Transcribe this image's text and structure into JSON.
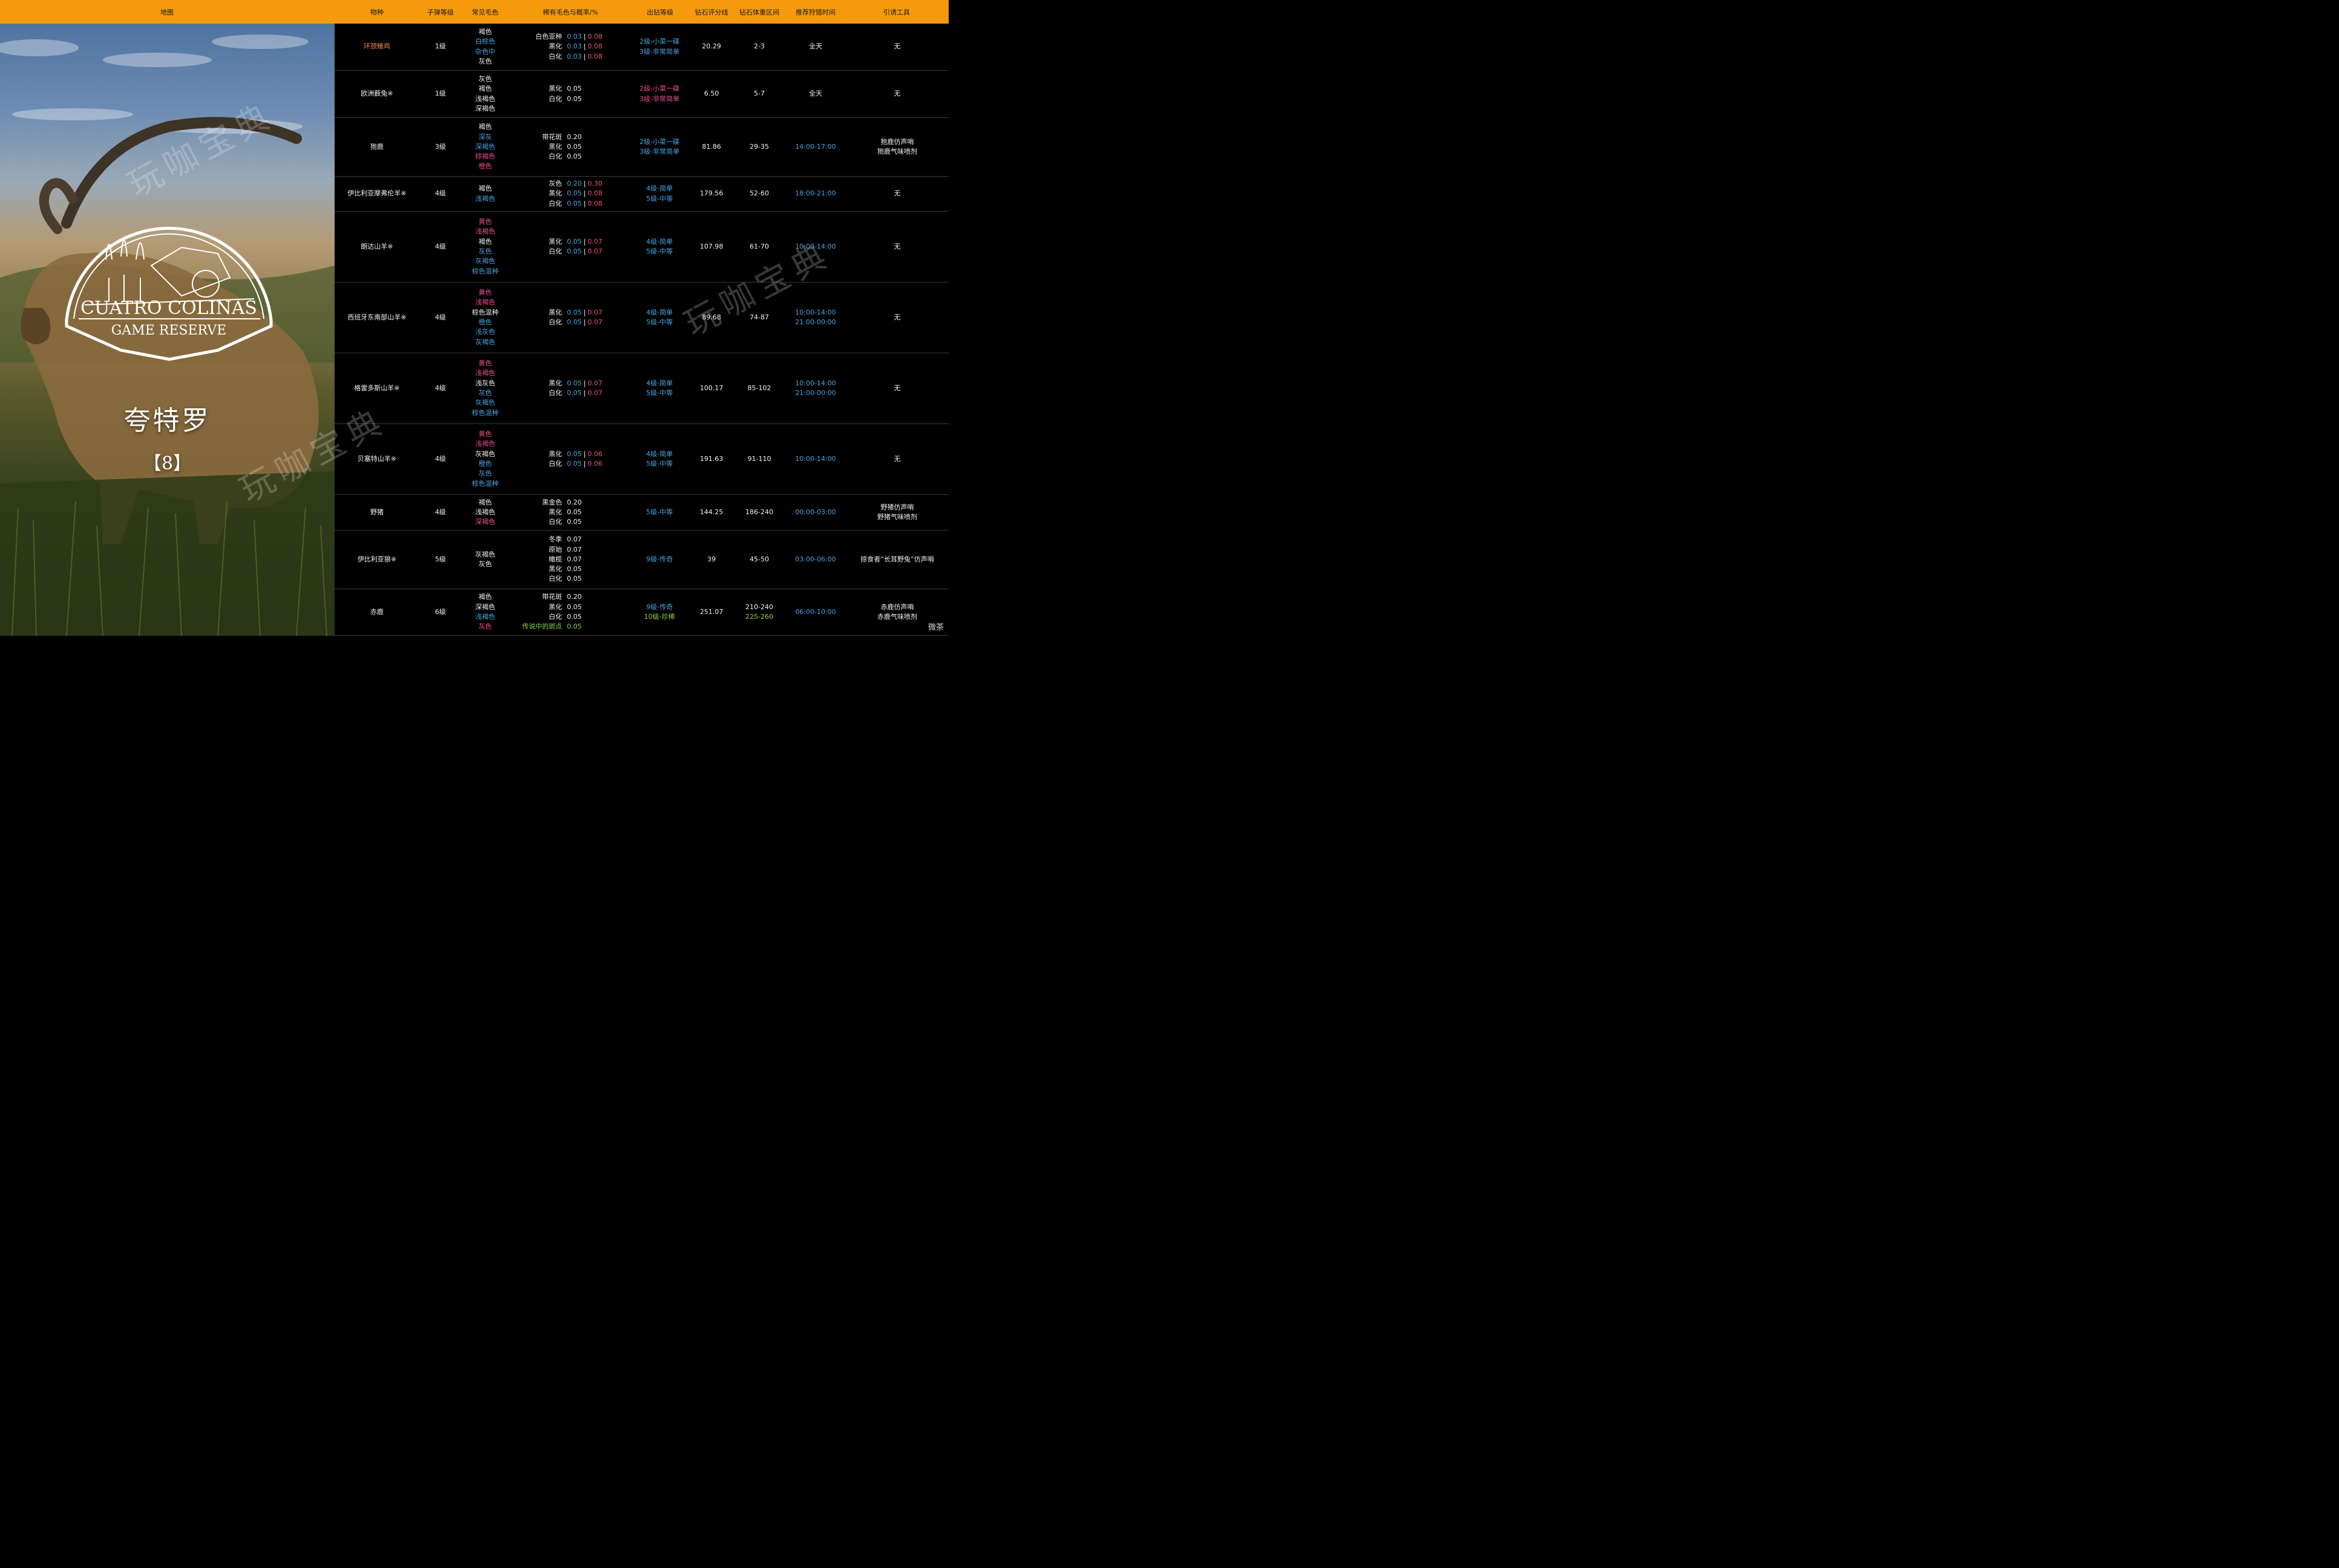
{
  "header": {
    "map": "地图",
    "species": "物种",
    "bullet": "子弹等级",
    "fur": "常见毛色",
    "rare": "稀有毛色与概率/%",
    "diamond_rank": "出钻等级",
    "score": "钻石评分线",
    "weight": "钻石体重区间",
    "time": "推荐狩猎时间",
    "lure": "引诱工具"
  },
  "map": {
    "logo_line1": "CUATRO COLINAS",
    "logo_line2": "GAME RESERVE",
    "name": "夸特罗",
    "count": "【8】",
    "watermark": "玩咖宝典"
  },
  "colors": {
    "white": "#f2f2f2",
    "blue": "#4aa3e0",
    "pink": "#e94f8c",
    "orange": "#f08a4b",
    "green": "#8fcf58",
    "header": "#f59a0c"
  },
  "rows": [
    {
      "species": {
        "text": "环颈雉鸡",
        "color": "o"
      },
      "bullet": "1级",
      "fur": [
        {
          "t": "褐色",
          "c": "w"
        },
        {
          "t": "白棕色",
          "c": "b"
        },
        {
          "t": "杂色中",
          "c": "b"
        },
        {
          "t": "灰色",
          "c": "w"
        }
      ],
      "rare": [
        {
          "name": "白色亚种",
          "nc": "w",
          "v1": "0.03",
          "c1": "b",
          "v2": "0.08",
          "c2": "p"
        },
        {
          "name": "黑化",
          "nc": "w",
          "v1": "0.03",
          "c1": "b",
          "v2": "0.08",
          "c2": "p"
        },
        {
          "name": "白化",
          "nc": "w",
          "v1": "0.03",
          "c1": "b",
          "v2": "0.08",
          "c2": "p"
        }
      ],
      "rank": [
        {
          "t": "2级-小菜一碟",
          "c": "b"
        },
        {
          "t": "3级-非常简单",
          "c": "b"
        }
      ],
      "score": "20.29",
      "weight": [
        {
          "t": "2-3",
          "c": "w"
        }
      ],
      "time": [
        {
          "t": "全天",
          "c": "w"
        }
      ],
      "lure": [
        "无"
      ]
    },
    {
      "species": {
        "text": "欧洲薮兔※",
        "color": "w"
      },
      "bullet": "1级",
      "fur": [
        {
          "t": "灰色",
          "c": "w"
        },
        {
          "t": "褐色",
          "c": "w"
        },
        {
          "t": "浅褐色",
          "c": "w"
        },
        {
          "t": "深褐色",
          "c": "w"
        }
      ],
      "rare": [
        {
          "name": "黑化",
          "nc": "w",
          "v1": "0.05",
          "c1": "w"
        },
        {
          "name": "白化",
          "nc": "w",
          "v1": "0.05",
          "c1": "w"
        }
      ],
      "rank": [
        {
          "t": "2级-小菜一碟",
          "c": "p"
        },
        {
          "t": "3级-非常简单",
          "c": "p"
        }
      ],
      "score": "6.50",
      "weight": [
        {
          "t": "5-7",
          "c": "w"
        }
      ],
      "time": [
        {
          "t": "全天",
          "c": "w"
        }
      ],
      "lure": [
        "无"
      ]
    },
    {
      "species": {
        "text": "狍鹿",
        "color": "w"
      },
      "bullet": "3级",
      "fur": [
        {
          "t": "褐色",
          "c": "w"
        },
        {
          "t": "深灰",
          "c": "b"
        },
        {
          "t": "深褐色",
          "c": "b"
        },
        {
          "t": "棕褐色",
          "c": "p"
        },
        {
          "t": "橙色",
          "c": "p"
        }
      ],
      "rare": [
        {
          "name": "带花斑",
          "nc": "w",
          "v1": "0.20",
          "c1": "w"
        },
        {
          "name": "黑化",
          "nc": "w",
          "v1": "0.05",
          "c1": "w"
        },
        {
          "name": "白化",
          "nc": "w",
          "v1": "0.05",
          "c1": "w"
        }
      ],
      "rank": [
        {
          "t": "2级-小菜一碟",
          "c": "b"
        },
        {
          "t": "3级-非常简单",
          "c": "b"
        }
      ],
      "score": "81.86",
      "weight": [
        {
          "t": "29-35",
          "c": "w"
        }
      ],
      "time": [
        {
          "t": "14:00-17:00",
          "c": "b"
        }
      ],
      "lure": [
        "狍鹿仿声哨",
        "狍鹿气味喷剂"
      ]
    },
    {
      "species": {
        "text": "伊比利亚摩弗伦羊※",
        "color": "w"
      },
      "bullet": "4级",
      "fur": [
        {
          "t": "褐色",
          "c": "w"
        },
        {
          "t": "浅褐色",
          "c": "b"
        }
      ],
      "rare": [
        {
          "name": "灰色",
          "nc": "w",
          "v1": "0.20",
          "c1": "b",
          "v2": "0.30",
          "c2": "p"
        },
        {
          "name": "黑化",
          "nc": "w",
          "v1": "0.05",
          "c1": "b",
          "v2": "0.08",
          "c2": "p"
        },
        {
          "name": "白化",
          "nc": "w",
          "v1": "0.05",
          "c1": "b",
          "v2": "0.08",
          "c2": "p"
        }
      ],
      "rank": [
        {
          "t": "4级-简单",
          "c": "b"
        },
        {
          "t": "5级-中等",
          "c": "b"
        }
      ],
      "score": "179.56",
      "weight": [
        {
          "t": "52-60",
          "c": "w"
        }
      ],
      "time": [
        {
          "t": "18:00-21:00",
          "c": "b"
        }
      ],
      "lure": [
        "无"
      ]
    },
    {
      "species": {
        "text": "朗达山羊※",
        "color": "w"
      },
      "bullet": "4级",
      "fur": [
        {
          "t": "黄色",
          "c": "p"
        },
        {
          "t": "浅褐色",
          "c": "p"
        },
        {
          "t": "褐色",
          "c": "w"
        },
        {
          "t": "灰色",
          "c": "b"
        },
        {
          "t": "灰褐色",
          "c": "b"
        },
        {
          "t": "棕色混种",
          "c": "b"
        }
      ],
      "rare": [
        {
          "name": "黑化",
          "nc": "w",
          "v1": "0.05",
          "c1": "b",
          "v2": "0.07",
          "c2": "p"
        },
        {
          "name": "白化",
          "nc": "w",
          "v1": "0.05",
          "c1": "b",
          "v2": "0.07",
          "c2": "p"
        }
      ],
      "rank": [
        {
          "t": "4级-简单",
          "c": "b"
        },
        {
          "t": "5级-中等",
          "c": "b"
        }
      ],
      "score": "107.98",
      "weight": [
        {
          "t": "61-70",
          "c": "w"
        }
      ],
      "time": [
        {
          "t": "10:00-14:00",
          "c": "b"
        }
      ],
      "lure": [
        "无"
      ]
    },
    {
      "species": {
        "text": "西班牙东南部山羊※",
        "color": "w"
      },
      "bullet": "4级",
      "fur": [
        {
          "t": "黄色",
          "c": "p"
        },
        {
          "t": "浅褐色",
          "c": "p"
        },
        {
          "t": "棕色混种",
          "c": "w"
        },
        {
          "t": "橙色",
          "c": "b"
        },
        {
          "t": "浅灰色",
          "c": "b"
        },
        {
          "t": "灰褐色",
          "c": "b"
        }
      ],
      "rare": [
        {
          "name": "黑化",
          "nc": "w",
          "v1": "0.05",
          "c1": "b",
          "v2": "0.07",
          "c2": "p"
        },
        {
          "name": "白化",
          "nc": "w",
          "v1": "0.05",
          "c1": "b",
          "v2": "0.07",
          "c2": "p"
        }
      ],
      "rank": [
        {
          "t": "4级-简单",
          "c": "b"
        },
        {
          "t": "5级-中等",
          "c": "b"
        }
      ],
      "score": "89.68",
      "weight": [
        {
          "t": "74-87",
          "c": "w"
        }
      ],
      "time": [
        {
          "t": "10:00-14:00",
          "c": "b"
        },
        {
          "t": "21:00-00:00",
          "c": "b"
        }
      ],
      "lure": [
        "无"
      ]
    },
    {
      "species": {
        "text": "格雷多斯山羊※",
        "color": "w"
      },
      "bullet": "4级",
      "fur": [
        {
          "t": "黄色",
          "c": "p"
        },
        {
          "t": "浅褐色",
          "c": "p"
        },
        {
          "t": "浅灰色",
          "c": "w"
        },
        {
          "t": "灰色",
          "c": "b"
        },
        {
          "t": "灰褐色",
          "c": "b"
        },
        {
          "t": "棕色混种",
          "c": "b"
        }
      ],
      "rare": [
        {
          "name": "黑化",
          "nc": "w",
          "v1": "0.05",
          "c1": "b",
          "v2": "0.07",
          "c2": "p"
        },
        {
          "name": "白化",
          "nc": "w",
          "v1": "0.05",
          "c1": "b",
          "v2": "0.07",
          "c2": "p"
        }
      ],
      "rank": [
        {
          "t": "4级-简单",
          "c": "b"
        },
        {
          "t": "5级-中等",
          "c": "b"
        }
      ],
      "score": "100.17",
      "weight": [
        {
          "t": "85-102",
          "c": "w"
        }
      ],
      "time": [
        {
          "t": "10:00-14:00",
          "c": "b"
        },
        {
          "t": "21:00-00:00",
          "c": "b"
        }
      ],
      "lure": [
        "无"
      ]
    },
    {
      "species": {
        "text": "贝塞特山羊※",
        "color": "w"
      },
      "bullet": "4级",
      "fur": [
        {
          "t": "黄色",
          "c": "p"
        },
        {
          "t": "浅褐色",
          "c": "p"
        },
        {
          "t": "灰褐色",
          "c": "w"
        },
        {
          "t": "橙色",
          "c": "b"
        },
        {
          "t": "灰色",
          "c": "b"
        },
        {
          "t": "棕色混种",
          "c": "b"
        }
      ],
      "rare": [
        {
          "name": "黑化",
          "nc": "w",
          "v1": "0.05",
          "c1": "b",
          "v2": "0.06",
          "c2": "p"
        },
        {
          "name": "白化",
          "nc": "w",
          "v1": "0.05",
          "c1": "b",
          "v2": "0.06",
          "c2": "p"
        }
      ],
      "rank": [
        {
          "t": "4级-简单",
          "c": "b"
        },
        {
          "t": "5级-中等",
          "c": "b"
        }
      ],
      "score": "191.63",
      "weight": [
        {
          "t": "91-110",
          "c": "w"
        }
      ],
      "time": [
        {
          "t": "10:00-14:00",
          "c": "b"
        }
      ],
      "lure": [
        "无"
      ]
    },
    {
      "species": {
        "text": "野猪",
        "color": "w"
      },
      "bullet": "4级",
      "fur": [
        {
          "t": "褐色",
          "c": "w"
        },
        {
          "t": "浅褐色",
          "c": "w"
        },
        {
          "t": "深褐色",
          "c": "p"
        }
      ],
      "rare": [
        {
          "name": "黑金色",
          "nc": "w",
          "v1": "0.20",
          "c1": "w"
        },
        {
          "name": "黑化",
          "nc": "w",
          "v1": "0.05",
          "c1": "w"
        },
        {
          "name": "白化",
          "nc": "w",
          "v1": "0.05",
          "c1": "w"
        }
      ],
      "rank": [
        {
          "t": "5级-中等",
          "c": "b"
        }
      ],
      "score": "144.25",
      "weight": [
        {
          "t": "186-240",
          "c": "w"
        }
      ],
      "time": [
        {
          "t": "00:00-03:00",
          "c": "b"
        }
      ],
      "lure": [
        "野猪仿声哨",
        "野猪气味喷剂"
      ]
    },
    {
      "species": {
        "text": "伊比利亚狼※",
        "color": "w"
      },
      "bullet": "5级",
      "fur": [
        {
          "t": "灰褐色",
          "c": "w"
        },
        {
          "t": "灰色",
          "c": "w"
        }
      ],
      "rare": [
        {
          "name": "冬季",
          "nc": "w",
          "v1": "0.07",
          "c1": "w"
        },
        {
          "name": "原始",
          "nc": "w",
          "v1": "0.07",
          "c1": "w"
        },
        {
          "name": "橄榄",
          "nc": "w",
          "v1": "0.07",
          "c1": "w"
        },
        {
          "name": "黑化",
          "nc": "w",
          "v1": "0.05",
          "c1": "w"
        },
        {
          "name": "白化",
          "nc": "w",
          "v1": "0.05",
          "c1": "w"
        }
      ],
      "rank": [
        {
          "t": "9级-传奇",
          "c": "b"
        }
      ],
      "score": "39",
      "weight": [
        {
          "t": "45-50",
          "c": "w"
        }
      ],
      "time": [
        {
          "t": "03:00-06:00",
          "c": "b"
        }
      ],
      "lure": [
        "掠食者“长耳野兔”仿声哨"
      ]
    },
    {
      "species": {
        "text": "赤鹿",
        "color": "w"
      },
      "bullet": "6级",
      "fur": [
        {
          "t": "褐色",
          "c": "w"
        },
        {
          "t": "深褐色",
          "c": "w"
        },
        {
          "t": "浅褐色",
          "c": "b"
        },
        {
          "t": "灰色",
          "c": "p"
        }
      ],
      "rare": [
        {
          "name": "带花斑",
          "nc": "w",
          "v1": "0.20",
          "c1": "w"
        },
        {
          "name": "黑化",
          "nc": "w",
          "v1": "0.05",
          "c1": "w"
        },
        {
          "name": "白化",
          "nc": "w",
          "v1": "0.05",
          "c1": "w"
        },
        {
          "name": "传说中的斑点",
          "nc": "g",
          "v1": "0.05",
          "c1": "g"
        }
      ],
      "rank": [
        {
          "t": "9级-传奇",
          "c": "b"
        },
        {
          "t": "10级-珍稀",
          "c": "g"
        }
      ],
      "score": "251.07",
      "weight": [
        {
          "t": "210-240",
          "c": "w"
        },
        {
          "t": "225-260",
          "c": "g"
        }
      ],
      "time": [
        {
          "t": "06:00-10:00",
          "c": "b"
        }
      ],
      "lure": [
        "赤鹿仿声哨",
        "赤鹿气味喷剂"
      ]
    }
  ],
  "footer": {
    "brand": "微茶"
  }
}
